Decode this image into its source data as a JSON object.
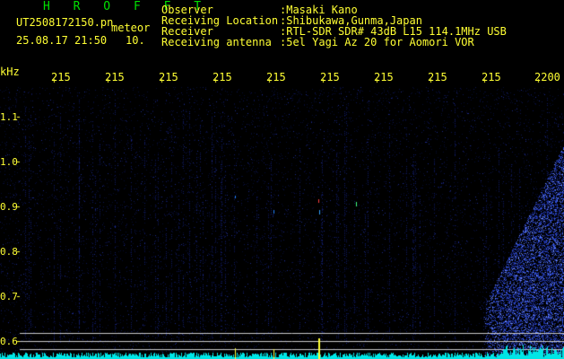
{
  "header": {
    "title": "H R O F F T",
    "filename": "UT2508172150.pn",
    "meteor_tag": "meteor",
    "datetime": "25.08.17 21:50",
    "interval": "10.",
    "meta": [
      {
        "label": "Observer",
        "value": ":Masaki Kano"
      },
      {
        "label": "Receiving Location",
        "value": ":Shibukawa,Gunma,Japan"
      },
      {
        "label": "Receiver",
        "value": ":RTL-SDR SDR# 43dB L15 114.1MHz USB"
      },
      {
        "label": "Receiving antenna",
        "value": ":5el Yagi Az 20 for Aomori VOR"
      }
    ]
  },
  "plot": {
    "y_unit": "kHz",
    "x_ticks": [
      "215",
      "215",
      "215",
      "215",
      "215",
      "215",
      "215",
      "215",
      "215",
      "2200"
    ],
    "y_ticks": [
      "1.1",
      "1.0",
      "0.9",
      "0.8",
      "0.7",
      "0.6"
    ],
    "colors": {
      "background": "#000000",
      "text": "#ffff33",
      "title": "#00e000",
      "trace": "#00ffff"
    }
  }
}
